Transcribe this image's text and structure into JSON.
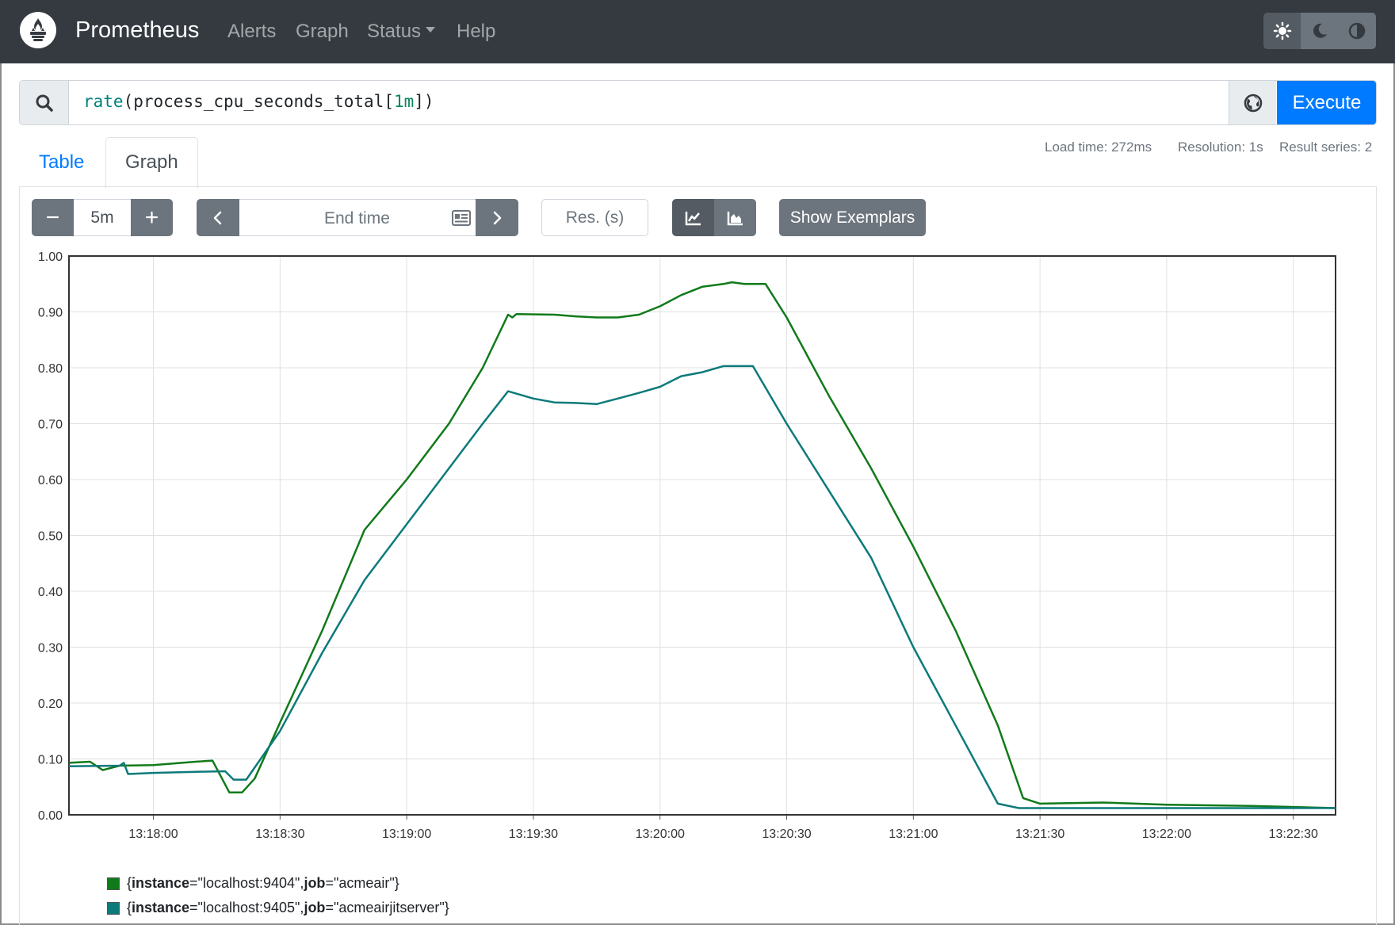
{
  "navbar": {
    "brand": "Prometheus",
    "links": {
      "alerts": "Alerts",
      "graph": "Graph",
      "status": "Status",
      "help": "Help"
    },
    "theme_buttons": [
      "light-theme",
      "dark-theme",
      "auto-theme"
    ]
  },
  "query": {
    "fn": "rate",
    "open": "(",
    "metric": "process_cpu_seconds_total",
    "lbracket": "[",
    "range": "1m",
    "close": "])",
    "execute_label": "Execute"
  },
  "tabs": {
    "table": "Table",
    "graph": "Graph"
  },
  "stats": {
    "load_time": "Load time: 272ms",
    "resolution": "Resolution: 1s",
    "result_series": "Result series: 2"
  },
  "controls": {
    "minus": "−",
    "range": "5m",
    "plus": "+",
    "end_time_placeholder": "End time",
    "res_placeholder": "Res. (s)",
    "show_exemplars": "Show Exemplars"
  },
  "legend": [
    {
      "key1": "instance",
      "val1": "=\"localhost:9404\", ",
      "key2": "job",
      "val2": "=\"acmeair\"}",
      "open": "{"
    },
    {
      "key1": "instance",
      "val1": "=\"localhost:9405\", ",
      "key2": "job",
      "val2": "=\"acmeairjitserver\"}",
      "open": "{"
    }
  ],
  "chart_data": {
    "type": "line",
    "xlabel": "",
    "ylabel": "",
    "ylim": [
      0,
      1.0
    ],
    "xlim": [
      "13:17:40",
      "13:22:40"
    ],
    "yticks": [
      "0.00",
      "0.10",
      "0.20",
      "0.30",
      "0.40",
      "0.50",
      "0.60",
      "0.70",
      "0.80",
      "0.90",
      "1.00"
    ],
    "xticks": [
      "13:18:00",
      "13:18:30",
      "13:19:00",
      "13:19:30",
      "13:20:00",
      "13:20:30",
      "13:21:00",
      "13:21:30",
      "13:22:00",
      "13:22:30"
    ],
    "grid": true,
    "series": [
      {
        "name": "{instance=\"localhost:9404\", job=\"acmeair\"}",
        "color": "#117a1a",
        "points": [
          [
            "13:17:40",
            0.093
          ],
          [
            "13:17:45",
            0.095
          ],
          [
            "13:17:48",
            0.08
          ],
          [
            "13:17:52",
            0.088
          ],
          [
            "13:18:00",
            0.089
          ],
          [
            "13:18:05",
            0.092
          ],
          [
            "13:18:10",
            0.095
          ],
          [
            "13:18:14",
            0.097
          ],
          [
            "13:18:18",
            0.04
          ],
          [
            "13:18:21",
            0.04
          ],
          [
            "13:18:24",
            0.065
          ],
          [
            "13:18:30",
            0.165
          ],
          [
            "13:18:40",
            0.33
          ],
          [
            "13:18:50",
            0.51
          ],
          [
            "13:19:00",
            0.6
          ],
          [
            "13:19:10",
            0.7
          ],
          [
            "13:19:18",
            0.8
          ],
          [
            "13:19:24",
            0.895
          ],
          [
            "13:19:25",
            0.89
          ],
          [
            "13:19:26",
            0.896
          ],
          [
            "13:19:35",
            0.895
          ],
          [
            "13:19:40",
            0.892
          ],
          [
            "13:19:45",
            0.89
          ],
          [
            "13:19:50",
            0.89
          ],
          [
            "13:19:55",
            0.895
          ],
          [
            "13:20:00",
            0.91
          ],
          [
            "13:20:05",
            0.93
          ],
          [
            "13:20:10",
            0.945
          ],
          [
            "13:20:15",
            0.95
          ],
          [
            "13:20:17",
            0.953
          ],
          [
            "13:20:20",
            0.95
          ],
          [
            "13:20:25",
            0.95
          ],
          [
            "13:20:30",
            0.89
          ],
          [
            "13:20:40",
            0.75
          ],
          [
            "13:20:50",
            0.62
          ],
          [
            "13:21:00",
            0.48
          ],
          [
            "13:21:10",
            0.33
          ],
          [
            "13:21:20",
            0.16
          ],
          [
            "13:21:26",
            0.03
          ],
          [
            "13:21:30",
            0.02
          ],
          [
            "13:21:45",
            0.022
          ],
          [
            "13:22:00",
            0.018
          ],
          [
            "13:22:20",
            0.016
          ],
          [
            "13:22:40",
            0.012
          ]
        ]
      },
      {
        "name": "{instance=\"localhost:9405\", job=\"acmeairjitserver\"}",
        "color": "#0d7a7a",
        "points": [
          [
            "13:17:40",
            0.087
          ],
          [
            "13:17:52",
            0.088
          ],
          [
            "13:17:53",
            0.093
          ],
          [
            "13:17:54",
            0.073
          ],
          [
            "13:18:00",
            0.075
          ],
          [
            "13:18:10",
            0.077
          ],
          [
            "13:18:17",
            0.078
          ],
          [
            "13:18:19",
            0.063
          ],
          [
            "13:18:22",
            0.063
          ],
          [
            "13:18:30",
            0.15
          ],
          [
            "13:18:40",
            0.29
          ],
          [
            "13:18:50",
            0.42
          ],
          [
            "13:19:00",
            0.52
          ],
          [
            "13:19:10",
            0.62
          ],
          [
            "13:19:18",
            0.7
          ],
          [
            "13:19:24",
            0.758
          ],
          [
            "13:19:30",
            0.745
          ],
          [
            "13:19:35",
            0.738
          ],
          [
            "13:19:40",
            0.737
          ],
          [
            "13:19:45",
            0.735
          ],
          [
            "13:19:50",
            0.745
          ],
          [
            "13:19:55",
            0.755
          ],
          [
            "13:20:00",
            0.766
          ],
          [
            "13:20:05",
            0.785
          ],
          [
            "13:20:10",
            0.792
          ],
          [
            "13:20:15",
            0.803
          ],
          [
            "13:20:22",
            0.803
          ],
          [
            "13:20:30",
            0.7
          ],
          [
            "13:20:40",
            0.58
          ],
          [
            "13:20:50",
            0.46
          ],
          [
            "13:21:00",
            0.3
          ],
          [
            "13:21:10",
            0.16
          ],
          [
            "13:21:20",
            0.02
          ],
          [
            "13:21:25",
            0.012
          ],
          [
            "13:22:00",
            0.012
          ],
          [
            "13:22:40",
            0.012
          ]
        ]
      }
    ]
  }
}
